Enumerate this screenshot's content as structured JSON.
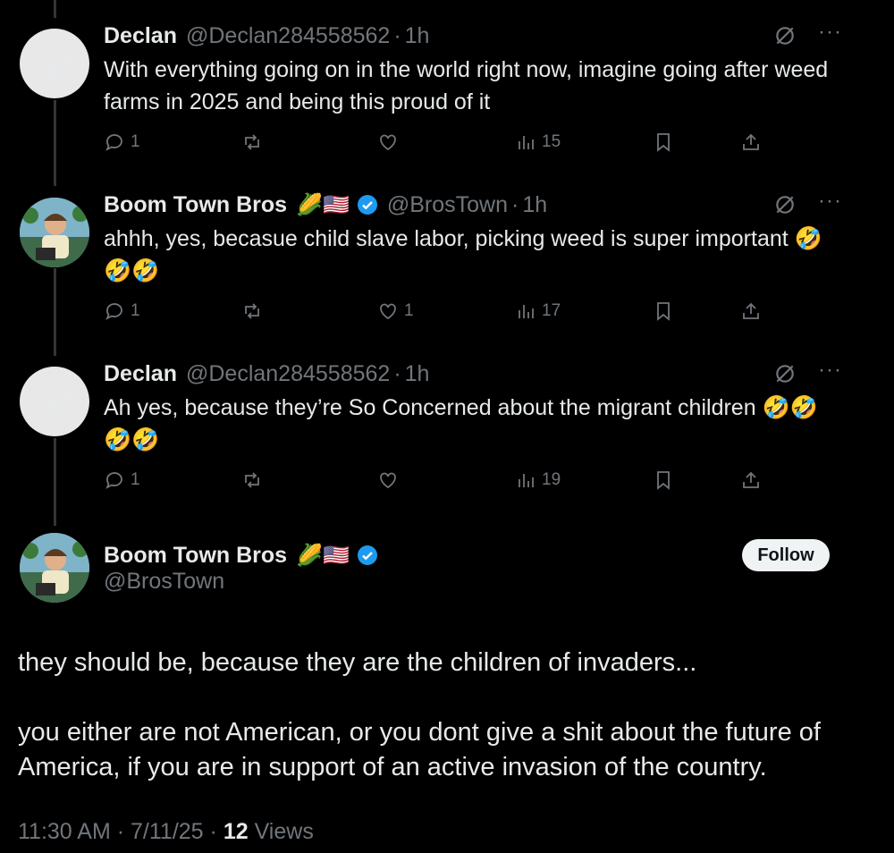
{
  "replies": [
    {
      "avatar_emoji": "😂",
      "name": "Declan",
      "handle": "@Declan284558562",
      "time": "1h",
      "text": "With everything going on in the world right now, imagine going after weed farms in 2025 and being this proud of it",
      "replies": "1",
      "likes": "",
      "views": "15"
    },
    {
      "name": "Boom Town Bros",
      "flags": "🌽🇺🇸",
      "handle": "@BrosTown",
      "time": "1h",
      "text": "ahhh, yes, becasue child slave labor, picking weed is super important 🤣🤣🤣",
      "replies": "1",
      "likes": "1",
      "views": "17"
    },
    {
      "avatar_emoji": "😂",
      "name": "Declan",
      "handle": "@Declan284558562",
      "time": "1h",
      "text": "Ah yes, because they’re So Concerned about the migrant children 🤣🤣🤣🤣",
      "replies": "1",
      "likes": "",
      "views": "19"
    }
  ],
  "main": {
    "name": "Boom Town Bros",
    "flags": "🌽🇺🇸",
    "handle": "@BrosTown",
    "follow_label": "Follow",
    "paragraph1": "they should be, because they are the children of invaders...",
    "paragraph2": "you either are not American, or you dont give a shit about the future of America, if you are in support of an active invasion of the country.",
    "time": "11:30 AM",
    "date": "7/11/25",
    "views_count": "12",
    "views_label": "Views"
  },
  "separator": "·",
  "more_icon": "···",
  "colors": {
    "background": "#000000",
    "text": "#e7e9ea",
    "muted": "#71767b",
    "verified": "#1d9bf0"
  }
}
